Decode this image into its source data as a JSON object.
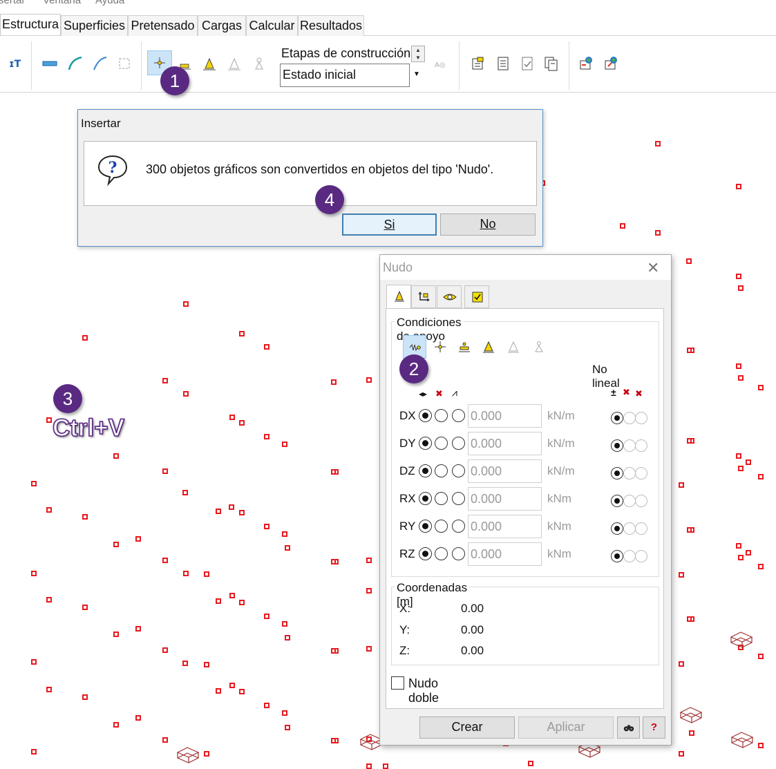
{
  "menu": {
    "items": [
      "sertar",
      "Ventana",
      "Ayuda"
    ]
  },
  "tabs": [
    "Estructura",
    "Superficies",
    "Pretensado",
    "Cargas",
    "Calcular",
    "Resultados"
  ],
  "toolbar": {
    "etapas_label": "Etapas de construcción:",
    "etapas_value": "Estado inicial"
  },
  "steps": {
    "s1": "1",
    "s2": "2",
    "s3": "3",
    "s4": "4",
    "shortcut": "Ctrl+V"
  },
  "insertar_dialog": {
    "title": "Insertar",
    "message": "300 objetos gráficos son convertidos en objetos del tipo 'Nudo'.",
    "yes_label": "Si",
    "no_label": "No"
  },
  "nudo_dialog": {
    "title": "Nudo",
    "close_glyph": "✕",
    "support_group_label": "Condiciones de apoyo",
    "nonlinear_label": "No lineal",
    "rows": [
      {
        "label": "DX",
        "value": "0.000",
        "unit": "kN/m"
      },
      {
        "label": "DY",
        "value": "0.000",
        "unit": "kN/m"
      },
      {
        "label": "DZ",
        "value": "0.000",
        "unit": "kN/m"
      },
      {
        "label": "RX",
        "value": "0.000",
        "unit": "kNm"
      },
      {
        "label": "RY",
        "value": "0.000",
        "unit": "kNm"
      },
      {
        "label": "RZ",
        "value": "0.000",
        "unit": "kNm"
      }
    ],
    "coords_group_label": "Coordenadas [m]",
    "coords": [
      {
        "label": "X:",
        "value": "0.00"
      },
      {
        "label": "Y:",
        "value": "0.00"
      },
      {
        "label": "Z:",
        "value": "0.00"
      }
    ],
    "double_node_label": "Nudo doble",
    "create_label": "Crear",
    "apply_label": "Aplicar",
    "help_glyph": "?"
  },
  "colors": {
    "node": "#e8191f",
    "badge": "#5a2a82",
    "selection": "#cce4f7"
  }
}
